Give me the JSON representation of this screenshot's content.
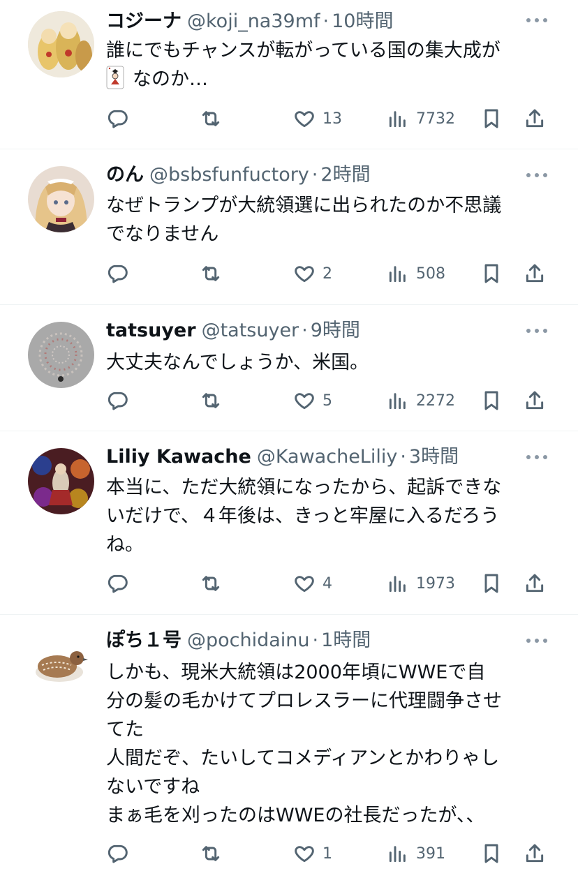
{
  "tweets": [
    {
      "name": "コジーナ",
      "handle": "@koji_na39mf",
      "separator": "·",
      "time": "10時間",
      "text": "誰にでもチャンスが転がっている国の集大成が",
      "text2": "なのか…",
      "has_emoji": true,
      "emoji_name": "joker-card-emoji",
      "likes": "13",
      "views": "7732",
      "avatar_icon": "matryoshka-dolls-avatar"
    },
    {
      "name": "のん",
      "handle": "@bsbsfunfuctory",
      "separator": "·",
      "time": "2時間",
      "text": "なぜトランプが大統領選に出られたのか不思議\nでなりません",
      "likes": "2",
      "views": "508",
      "avatar_icon": "anime-maid-avatar"
    },
    {
      "name": "tatsuyer",
      "handle": "@tatsuyer",
      "separator": "·",
      "time": "9時間",
      "text": "大丈夫なんでしょうか、米国。",
      "likes": "5",
      "views": "2272",
      "avatar_icon": "beaded-necklace-avatar"
    },
    {
      "name": "Liliy Kawache",
      "handle": "@KawacheLiliy",
      "separator": "·",
      "time": "3時間",
      "text": "本当に、ただ大統領になったから、起訴できな\nいだけで、４年後は、きっと牢屋に入るだろう\nね。",
      "likes": "4",
      "views": "1973",
      "avatar_icon": "stained-glass-avatar"
    },
    {
      "name": "ぽち１号",
      "handle": "@pochidainu",
      "separator": "·",
      "time": "1時間",
      "text": "しかも、現米大統領は2000年頃にWWEで自\n分の髪の毛かけてプロレスラーに代理闘争させ\nてた\n人間だぞ、たいしてコメディアンとかわりゃし\nないですね\nまぁ毛を刈ったのはWWEの社長だったが、、",
      "likes": "1",
      "views": "391",
      "avatar_icon": "quail-avatar"
    }
  ],
  "colors": {
    "text": "#0f1419",
    "secondary": "#536471",
    "divider": "#eff3f4"
  },
  "icons": [
    "reply-icon",
    "retweet-icon",
    "like-icon",
    "views-icon",
    "bookmark-icon",
    "share-icon",
    "more-icon"
  ]
}
